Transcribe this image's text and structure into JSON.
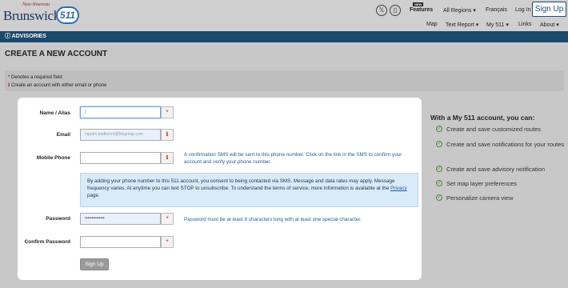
{
  "header": {
    "logo": {
      "small": "New-Nouveau",
      "big": "Brunswick",
      "badge": "511"
    },
    "features": {
      "new_badge": "NEW",
      "label": "Features"
    },
    "regions": "All Regions ▾",
    "language": "Français",
    "login": "Log In",
    "signup": "Sign Up",
    "nav": [
      "Map",
      "Text Report ▾",
      "My 511 ▾",
      "Links",
      "About ▾"
    ]
  },
  "advisories": "ⓘ ADVISORIES",
  "page_title": "CREATE A NEW ACCOUNT",
  "notice": {
    "required": "* Denotes a required field",
    "info": "Create an account with either email or phone"
  },
  "form": {
    "name_label": "Name / Alias",
    "email_label": "Email",
    "email_value": "nqadm.bodkonrd@blogroup.com",
    "phone_label": "Mobile Phone",
    "phone_hint": "A confirmation SMS will be sent to this phone number. Click on the link in the SMS to confirm your account and verify your phone number.",
    "sms_text": "By adding your phone number to this 511 account, you consent to being contacted via SMS. Message and data rates may apply. Message frequency varies. At anytime you can text STOP to unsubscribe. To understand the terms of service, more information is available at the",
    "privacy_link": "Privacy",
    "sms_tail": "page.",
    "password_label": "Password",
    "password_value": "••••••••••••••",
    "password_hint": "Password must be at least 8 characters long with at least one special character.",
    "confirm_label": "Confirm Password",
    "submit": "Sign Up"
  },
  "sidebar": {
    "title": "With a My 511 account, you can:",
    "items": [
      "Create and save customized routes",
      "Create and save notifications for your routes",
      "Create and save advisory notification",
      "Set map layer preferences",
      "Personalize camera view"
    ]
  }
}
